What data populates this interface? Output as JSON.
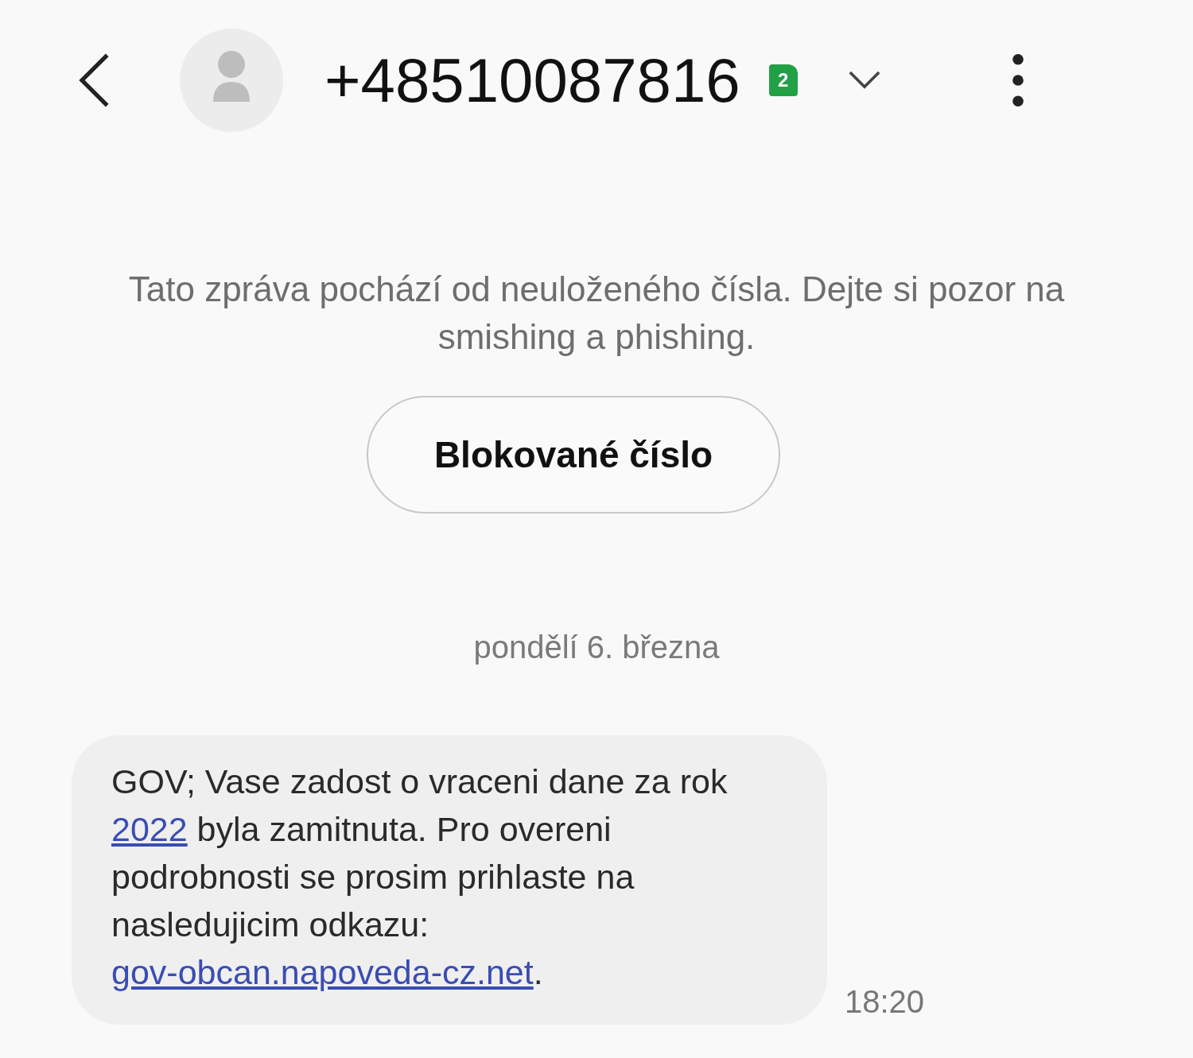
{
  "header": {
    "title": "+48510087816",
    "sim_badge": "2"
  },
  "warning": "Tato zpráva pochází od neuloženého čísla. Dejte si pozor na smishing a phishing.",
  "block_button": "Blokované číslo",
  "date": "pondělí 6. března",
  "messages": [
    {
      "segments": [
        {
          "kind": "text",
          "text": "GOV; Vase zadost o vraceni dane za rok "
        },
        {
          "kind": "link",
          "text": "2022"
        },
        {
          "kind": "text",
          "text": " byla zamitnuta. Pro overeni podrobnosti se prosim prihlaste na nasledujicim odkazu: "
        },
        {
          "kind": "link",
          "text": "gov-obcan.napoveda-cz.net"
        },
        {
          "kind": "text",
          "text": "."
        }
      ],
      "time": "18:20"
    }
  ]
}
